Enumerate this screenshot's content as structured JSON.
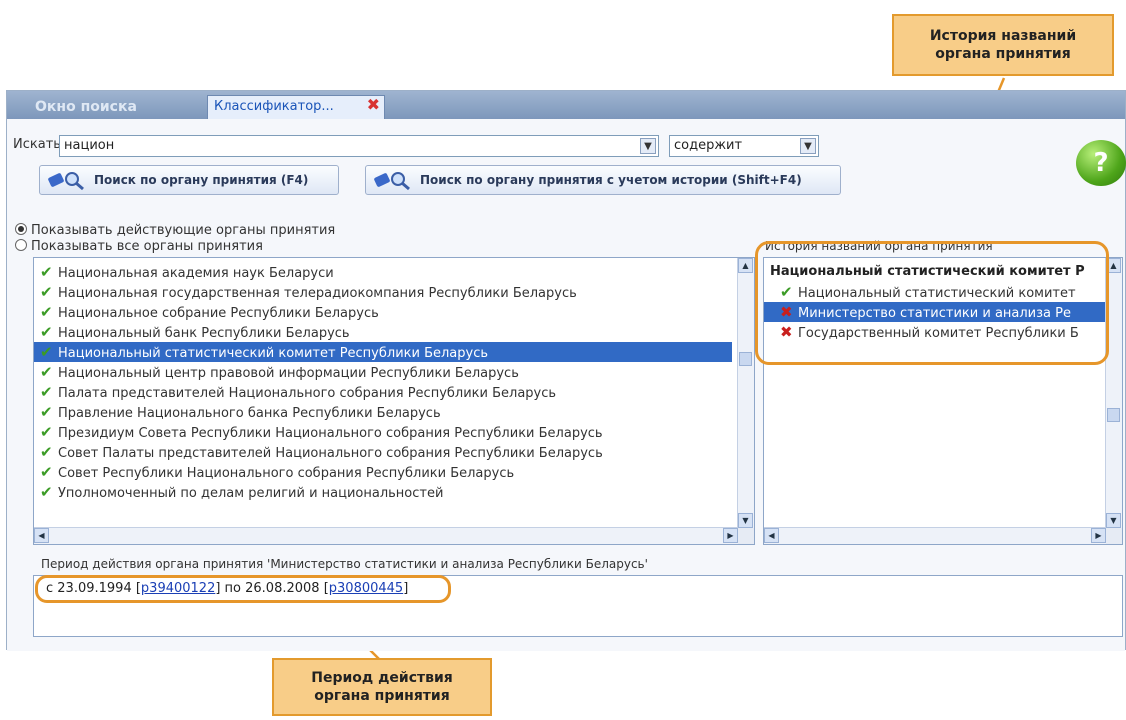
{
  "callouts": {
    "history_names": "История названий органа принятия",
    "period": "Период действия органа принятия"
  },
  "tabs": [
    {
      "label": "Окно поиска",
      "active": false
    },
    {
      "label": "Классификатор...",
      "active": true,
      "close": "✖"
    }
  ],
  "search": {
    "label": "Искать",
    "value": "национ",
    "mode_value": "содержит"
  },
  "buttons": {
    "search_by_body": "Поиск по органу принятия (F4)",
    "search_with_history": "Поиск по органу принятия с учетом истории (Shift+F4)",
    "help": "?"
  },
  "radios": [
    {
      "label": "Показывать действующие органы принятия",
      "checked": true
    },
    {
      "label": "Показывать все органы принятия",
      "checked": false
    }
  ],
  "bodies_list": [
    {
      "text": "Национальная академия наук Беларуси",
      "status": "active"
    },
    {
      "text": "Национальная государственная телерадиокомпания Республики Беларусь",
      "status": "active"
    },
    {
      "text": "Национальное собрание Республики Беларусь",
      "status": "active"
    },
    {
      "text": "Национальный банк Республики Беларусь",
      "status": "active"
    },
    {
      "text": "Национальный статистический комитет Республики Беларусь",
      "status": "active",
      "selected": true
    },
    {
      "text": "Национальный центр правовой информации Республики Беларусь",
      "status": "active"
    },
    {
      "text": "Палата представителей Национального собрания Республики Беларусь",
      "status": "active"
    },
    {
      "text": "Правление Национального банка Республики Беларусь",
      "status": "active"
    },
    {
      "text": "Президиум Совета Республики Национального собрания Республики Беларусь",
      "status": "active"
    },
    {
      "text": "Совет Палаты представителей Национального собрания Республики Беларусь",
      "status": "active"
    },
    {
      "text": "Совет Республики Национального собрания Республики Беларусь",
      "status": "active"
    },
    {
      "text": "Уполномоченный по делам религий и национальностей",
      "status": "active"
    }
  ],
  "history": {
    "title": "История названий органа принятия",
    "header": "Национальный статистический комитет Р",
    "items": [
      {
        "text": "Национальный статистический комитет",
        "status": "active"
      },
      {
        "text": "Министерство статистики и анализа Ре",
        "status": "inactive",
        "selected": true
      },
      {
        "text": "Государственный комитет Республики Б",
        "status": "inactive"
      }
    ]
  },
  "period": {
    "title": "Период действия органа принятия 'Министерство статистики и анализа Республики Беларусь'",
    "from_prefix": "с 23.09.1994 [",
    "from_link": "p39400122",
    "mid": "] по 26.08.2008 [",
    "to_link": "p30800445",
    "suffix": "]"
  }
}
